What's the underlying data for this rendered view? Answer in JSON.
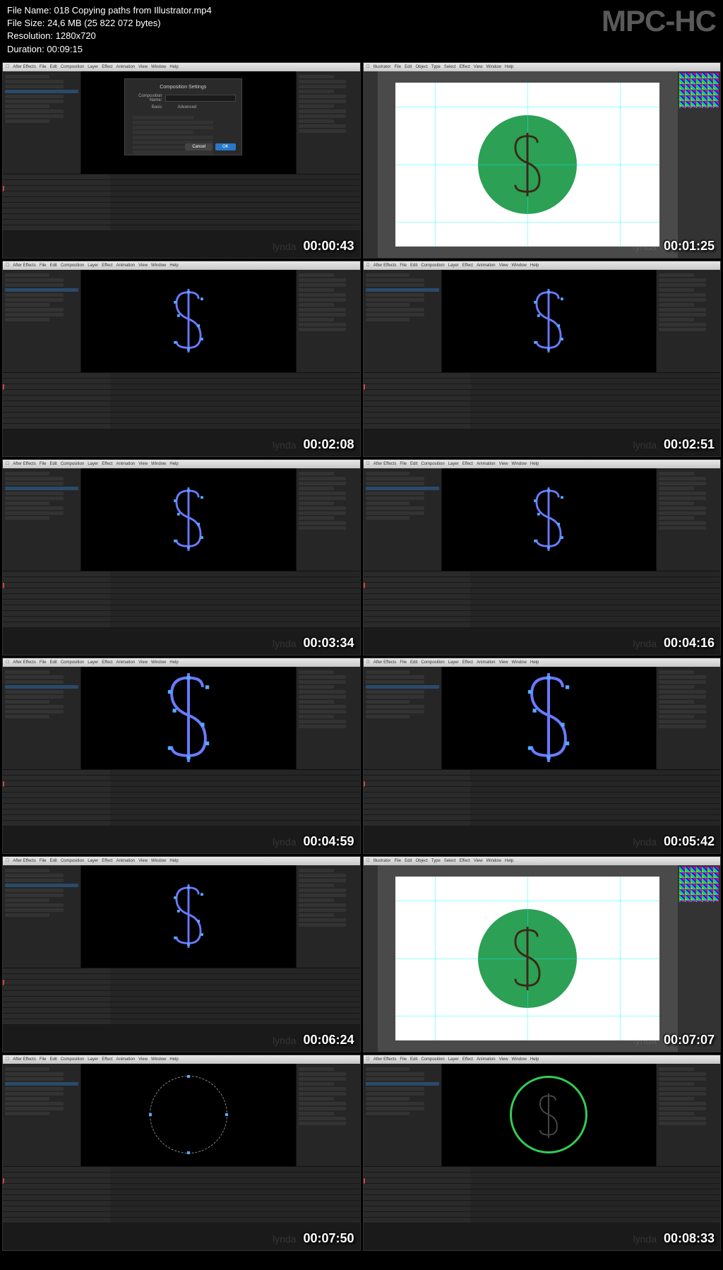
{
  "header": {
    "file_name_label": "File Name:",
    "file_name": "018 Copying paths from Illustrator.mp4",
    "file_size_label": "File Size:",
    "file_size": "24,6 MB (25 822 072 bytes)",
    "resolution_label": "Resolution:",
    "resolution": "1280x720",
    "duration_label": "Duration:",
    "duration": "00:09:15",
    "logo": "MPC-HC"
  },
  "ae_menu": [
    "After Effects",
    "File",
    "Edit",
    "Composition",
    "Layer",
    "Effect",
    "Animation",
    "View",
    "Window",
    "Help"
  ],
  "ai_menu": [
    "Illustrator",
    "File",
    "Edit",
    "Object",
    "Type",
    "Select",
    "Effect",
    "View",
    "Window",
    "Help"
  ],
  "dialog": {
    "title": "Composition Settings",
    "name_label": "Composition Name:",
    "advanced": "Advanced",
    "cancel": "Cancel",
    "ok": "OK"
  },
  "watermark": "lynda",
  "thumbs": [
    {
      "ts": "00:00:43",
      "type": "ae-dialog"
    },
    {
      "ts": "00:01:25",
      "type": "ai-green"
    },
    {
      "ts": "00:02:08",
      "type": "ae-s"
    },
    {
      "ts": "00:02:51",
      "type": "ae-s"
    },
    {
      "ts": "00:03:34",
      "type": "ae-s"
    },
    {
      "ts": "00:04:16",
      "type": "ae-s"
    },
    {
      "ts": "00:04:59",
      "type": "ae-s-big"
    },
    {
      "ts": "00:05:42",
      "type": "ae-s-big"
    },
    {
      "ts": "00:06:24",
      "type": "ae-s"
    },
    {
      "ts": "00:07:07",
      "type": "ai-green"
    },
    {
      "ts": "00:07:50",
      "type": "ae-circle"
    },
    {
      "ts": "00:08:33",
      "type": "ae-green-circle"
    }
  ]
}
